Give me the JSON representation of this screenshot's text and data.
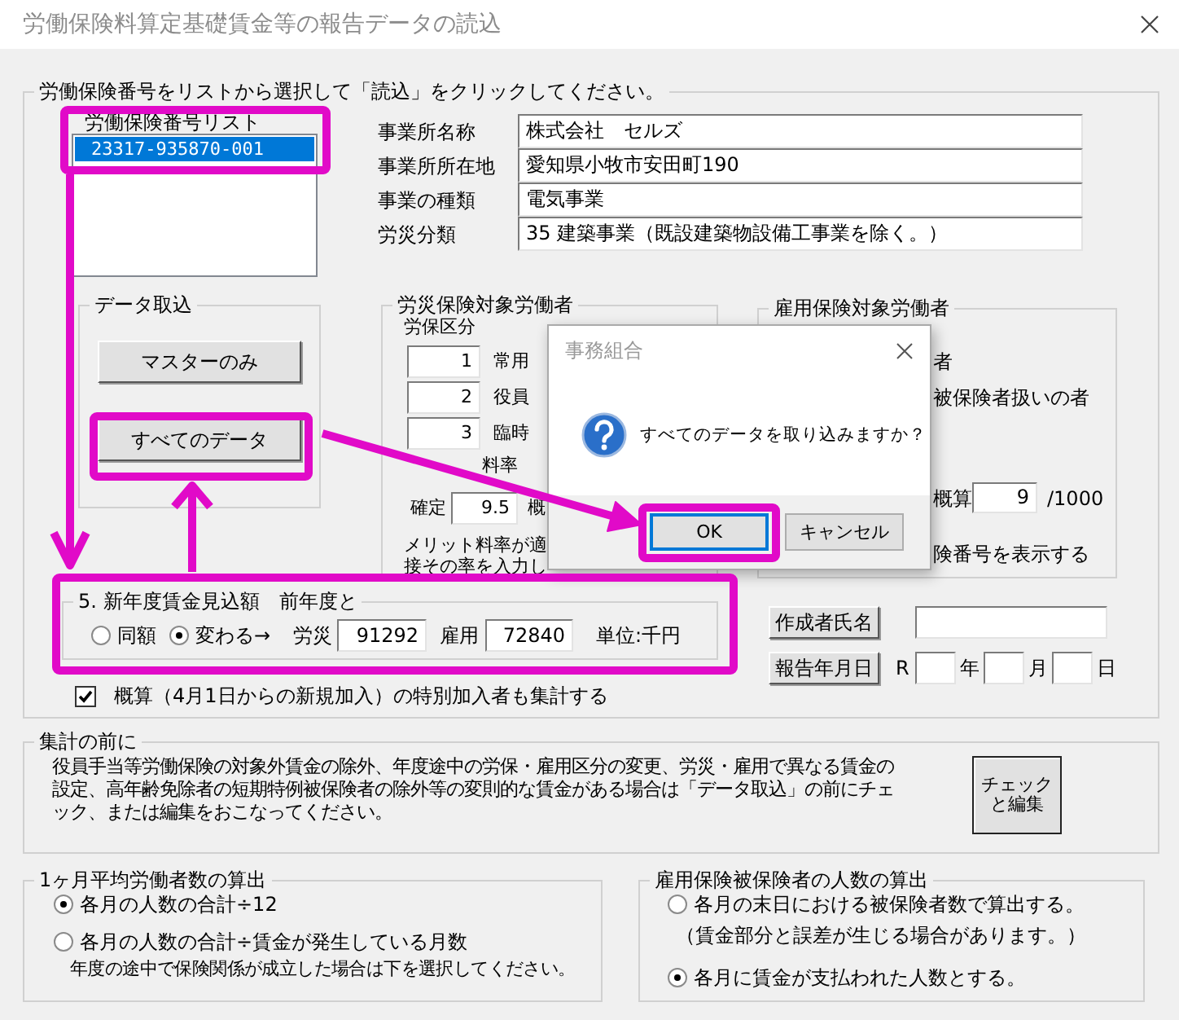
{
  "window": {
    "title": "労働保険料算定基礎賃金等の報告データの読込"
  },
  "main_group": {
    "legend": "労働保険番号をリストから選択して「読込」をクリックしてください。",
    "list": {
      "label": "労働保険番号リスト",
      "items": [
        {
          "text": "23317-935870-001",
          "selected": true
        }
      ]
    },
    "import_group": {
      "legend": "データ取込",
      "buttons": [
        "マスターのみ",
        "すべてのデータ"
      ]
    },
    "office_fields": [
      {
        "label": "事業所名称",
        "value": "株式会社　セルズ"
      },
      {
        "label": "事業所所在地",
        "value": "愛知県小牧市安田町190"
      },
      {
        "label": "事業の種類",
        "value": "電気事業"
      },
      {
        "label": "労災分類",
        "value": "35 建築事業（既設建築物設備工事業を除く。）"
      }
    ],
    "rosai_group": {
      "legend": "労災保険対象労働者",
      "category_heading": "労保区分",
      "categories": [
        {
          "code": "1",
          "label": "常用"
        },
        {
          "code": "2",
          "label": "役員"
        },
        {
          "code": "3",
          "label": "臨時"
        }
      ],
      "rate_heading": "料率",
      "rate_label": "確定",
      "rate_value": "9.5",
      "rate_next": "概",
      "note_lines": [
        "メリット料率が適",
        "接その率を入力し"
      ]
    },
    "koyo_group": {
      "legend": "雇用保険対象労働者",
      "lines": [
        "者",
        "被保険者扱いの者"
      ],
      "rate_label": "概算",
      "rate_value": "9",
      "rate_unit": "/1000",
      "note": "険番号を表示する"
    },
    "estimate_group": {
      "legend": "5. 新年度賃金見込額　前年度と",
      "options": [
        {
          "label": "同額",
          "selected": false
        },
        {
          "label": "変わる→",
          "selected": true
        }
      ],
      "rosai_label": "労災",
      "rosai_value": "91292",
      "koyo_label": "雇用",
      "koyo_value": "72840",
      "unit": "単位:千円"
    },
    "author": {
      "button": "作成者氏名"
    },
    "report_date": {
      "button": "報告年月日",
      "era": "R",
      "units": [
        "年",
        "月",
        "日"
      ]
    },
    "special_checkbox": {
      "label": "概算（4月1日からの新規加入）の特別加入者も集計する",
      "checked": true
    }
  },
  "summary_group": {
    "legend": "集計の前に",
    "text": "役員手当等労働保険の対象外賃金の除外、年度途中の労保・雇用区分の変更、労災・雇用で異なる賃金の設定、高年齢免除者の短期特例被保険者の除外等の変則的な賃金がある場合は「データ取込」の前にチェック、または編集をおこなってください。",
    "button": "チェックと編集"
  },
  "average_group": {
    "legend": "1ヶ月平均労働者数の算出",
    "options": [
      {
        "label": "各月の人数の合計÷12",
        "selected": true
      },
      {
        "label": "各月の人数の合計÷賃金が発生している月数",
        "selected": false
      }
    ],
    "note": "年度の途中で保険関係が成立した場合は下を選択してください。"
  },
  "koyo_count_group": {
    "legend": "雇用保険被保険者の人数の算出",
    "options": [
      {
        "label": "各月の末日における被保険者数で算出する。",
        "note": "（賃金部分と誤差が生じる場合があります。）",
        "selected": false
      },
      {
        "label": "各月に賃金が支払われた人数とする。",
        "selected": true
      }
    ]
  },
  "dialog": {
    "title": "事務組合",
    "message": "すべてのデータを取り込みますか？",
    "buttons": [
      {
        "label": "OK",
        "focused": true
      },
      {
        "label": "キャンセル",
        "focused": false
      }
    ]
  }
}
